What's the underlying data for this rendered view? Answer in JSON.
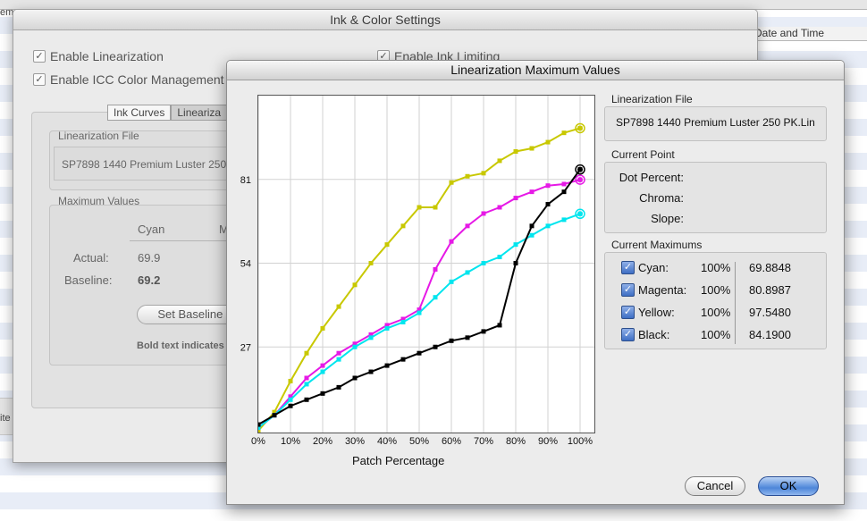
{
  "background": {
    "side_fragment_top": "em",
    "side_fragment_bottom": "ite",
    "column_header": "Date and Time"
  },
  "ink_window": {
    "title": "Ink & Color Settings",
    "enable_linearization": "Enable Linearization",
    "enable_ink_limiting": "Enable Ink Limiting",
    "enable_icc": "Enable ICC Color Management",
    "tabs": [
      "Ink Curves",
      "Lineariza"
    ],
    "linearization_file_label": "Linearization File",
    "linearization_file_value": "SP7898 1440 Premium Luster 250",
    "max_values_label": "Maximum Values",
    "col_cyan": "Cyan",
    "col_m": "M",
    "actual_label": "Actual:",
    "actual_value": "69.9",
    "baseline_label": "Baseline:",
    "baseline_value": "69.2",
    "set_baseline_btn": "Set Baseline V",
    "bold_note": "Bold text indicates"
  },
  "lin_window": {
    "title": "Linearization Maximum Values",
    "linearization_file_label": "Linearization File",
    "linearization_file_value": "SP7898 1440 Premium Luster 250 PK.Lin",
    "current_point_label": "Current Point",
    "dot_percent_label": "Dot Percent:",
    "chroma_label": "Chroma:",
    "slope_label": "Slope:",
    "current_maximums_label": "Current Maximums",
    "maximums": [
      {
        "name": "Cyan:",
        "percent": "100%",
        "value": "69.8848"
      },
      {
        "name": "Magenta:",
        "percent": "100%",
        "value": "80.8987"
      },
      {
        "name": "Yellow:",
        "percent": "100%",
        "value": "97.5480"
      },
      {
        "name": "Black:",
        "percent": "100%",
        "value": "84.1900"
      }
    ],
    "cancel_btn": "Cancel",
    "ok_btn": "OK"
  },
  "chart_data": {
    "type": "line",
    "xlabel": "Patch Percentage",
    "ylabel": "",
    "xlim": [
      0,
      100
    ],
    "ylim": [
      0,
      108
    ],
    "x_ticks": [
      "0%",
      "10%",
      "20%",
      "30%",
      "40%",
      "50%",
      "60%",
      "70%",
      "80%",
      "90%",
      "100%"
    ],
    "y_ticks": [
      27,
      54,
      81
    ],
    "grid": true,
    "x": [
      0,
      5,
      10,
      15,
      20,
      25,
      30,
      35,
      40,
      45,
      50,
      55,
      60,
      65,
      70,
      75,
      80,
      85,
      90,
      95,
      100
    ],
    "series": [
      {
        "color": "#c8c800",
        "values": [
          0,
          6,
          16,
          25,
          33,
          40,
          47,
          54,
          60,
          66,
          72,
          72,
          80,
          82,
          83,
          87,
          90,
          91,
          93,
          96,
          97.5
        ]
      },
      {
        "color": "#e619e6",
        "values": [
          1,
          5,
          11,
          17,
          21,
          25,
          28,
          31,
          34,
          36,
          39,
          52,
          61,
          66,
          70,
          72,
          75,
          77,
          79,
          79.5,
          80.9
        ]
      },
      {
        "color": "#00e5ee",
        "values": [
          1,
          5,
          10,
          15,
          19,
          23,
          27,
          30,
          33,
          35,
          38,
          43,
          48,
          51,
          54,
          56,
          60,
          63,
          66,
          68,
          69.9
        ]
      },
      {
        "color": "#000000",
        "values": [
          2,
          5,
          8,
          10,
          12,
          14,
          17,
          19,
          21,
          23,
          25,
          27,
          29,
          30,
          32,
          34,
          54,
          66,
          73,
          77,
          84.2
        ]
      }
    ]
  }
}
